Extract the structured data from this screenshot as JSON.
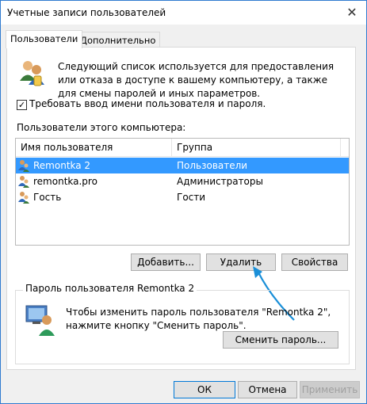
{
  "window": {
    "title": "Учетные записи пользователей",
    "close_glyph": "✕"
  },
  "tabs": [
    {
      "label": "Пользователи",
      "active": true
    },
    {
      "label": "Дополнительно",
      "active": false
    }
  ],
  "intro": {
    "text": "Следующий список используется для предоставления или отказа в доступе к вашему компьютеру, а также для смены паролей и иных параметров.",
    "icon": "users-icon"
  },
  "require_login": {
    "label": "Требовать ввод имени пользователя и пароля.",
    "checked": true,
    "check_glyph": "✓"
  },
  "users_section": {
    "label": "Пользователи этого компьютера:",
    "columns": [
      "Имя пользователя",
      "Группа"
    ],
    "rows": [
      {
        "name": "Remontka 2",
        "group": "Пользователи",
        "selected": true
      },
      {
        "name": "remontka.pro",
        "group": "Администраторы",
        "selected": false
      },
      {
        "name": "Гость",
        "group": "Гости",
        "selected": false
      }
    ]
  },
  "user_buttons": {
    "add": "Добавить...",
    "remove": "Удалить",
    "properties": "Свойства"
  },
  "password_group": {
    "title": "Пароль пользователя Remontka 2",
    "text": "Чтобы изменить пароль пользователя \"Remontka 2\", нажмите кнопку \"Сменить пароль\".",
    "change_button": "Сменить пароль..."
  },
  "dialog_buttons": {
    "ok": "ОК",
    "cancel": "Отмена",
    "apply": "Применить"
  },
  "colors": {
    "selection": "#3399ff",
    "arrow": "#1a8fd8",
    "focus_border": "#0078d7"
  }
}
